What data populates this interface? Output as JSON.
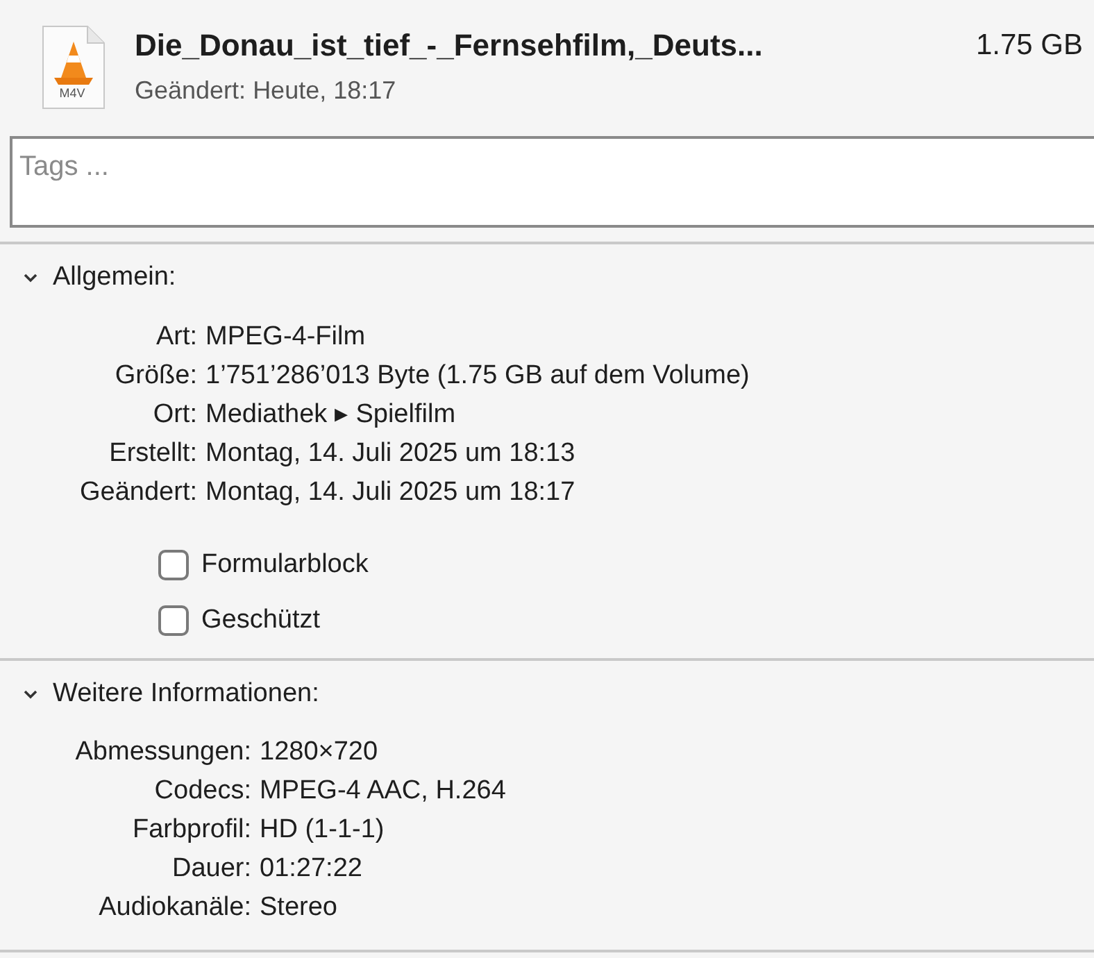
{
  "file": {
    "icon_label": "M4V",
    "name": "Die_Donau_ist_tief_-_Fernsehfilm,_Deuts...",
    "size": "1.75 GB",
    "modified_label": "Geändert:",
    "modified_value": "Heute, 18:17"
  },
  "tags": {
    "placeholder": "Tags ..."
  },
  "sections": [
    {
      "title": "Allgemein:",
      "expanded": true,
      "rows": [
        {
          "label": "Art:",
          "value": "MPEG-4-Film"
        },
        {
          "label": "Größe:",
          "value": "1’751’286’013 Byte (1.75 GB auf dem Volume)"
        },
        {
          "label": "Ort:",
          "value": "Mediathek ▸ Spielfilm"
        },
        {
          "label": "Erstellt:",
          "value": "Montag, 14. Juli 2025 um 18:13"
        },
        {
          "label": "Geändert:",
          "value": "Montag, 14. Juli 2025 um 18:17"
        }
      ],
      "checkboxes": [
        {
          "label": "Formularblock",
          "checked": false
        },
        {
          "label": "Geschützt",
          "checked": false
        }
      ]
    },
    {
      "title": "Weitere Informationen:",
      "expanded": true,
      "rows": [
        {
          "label": "Abmessungen:",
          "value": "1280×720"
        },
        {
          "label": "Codecs:",
          "value": "MPEG-4 AAC, H.264"
        },
        {
          "label": "Farbprofil:",
          "value": "HD (1-1-1)"
        },
        {
          "label": "Dauer:",
          "value": "01:27:22"
        },
        {
          "label": "Audiokanäle:",
          "value": "Stereo"
        }
      ]
    }
  ]
}
